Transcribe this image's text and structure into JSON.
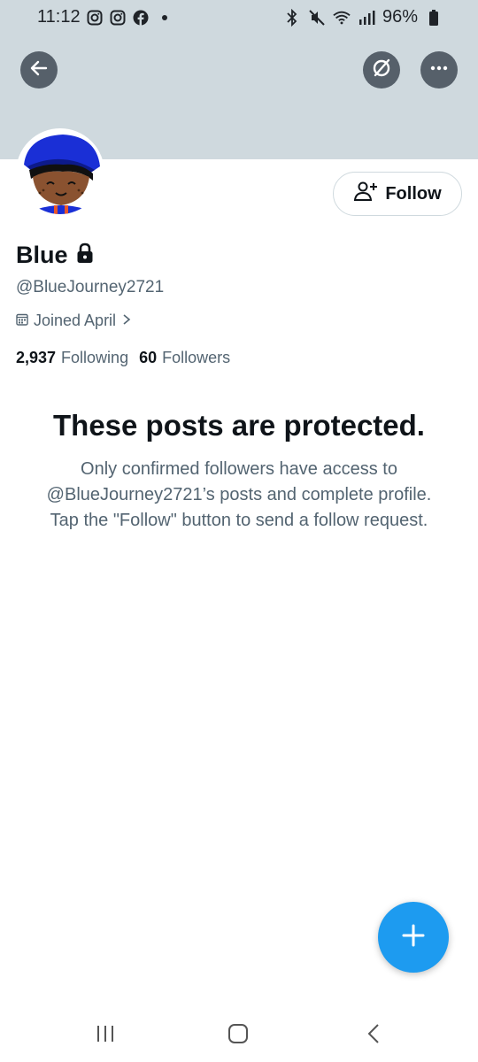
{
  "status_bar": {
    "time": "11:12",
    "battery": "96%",
    "left_icons": [
      "instagram-icon",
      "instagram-icon",
      "facebook-icon"
    ],
    "right_icons": [
      "bluetooth-icon",
      "mute-icon",
      "wifi-icon",
      "signal-icon",
      "battery-icon"
    ]
  },
  "header": {
    "banner_color": "#cfd9de",
    "buttons": [
      "back-arrow-icon",
      "grok-icon",
      "more-icon"
    ]
  },
  "profile": {
    "name": "Blue",
    "handle": "@BlueJourney2721",
    "joined": "Joined April",
    "following_count": "2,937",
    "following_label": "Following",
    "followers_count": "60",
    "followers_label": "Followers",
    "locked": true
  },
  "follow_button": {
    "label": "Follow"
  },
  "protected": {
    "title": "These posts are protected.",
    "body": "Only confirmed followers have access to @BlueJourney2721’s posts and complete profile. Tap the \"Follow\" button to send a follow request."
  },
  "fab": {
    "icon": "plus-icon",
    "color": "#1d9bf0"
  },
  "nav_bar": {
    "buttons": [
      "recent-apps-icon",
      "home-icon",
      "back-icon"
    ]
  }
}
